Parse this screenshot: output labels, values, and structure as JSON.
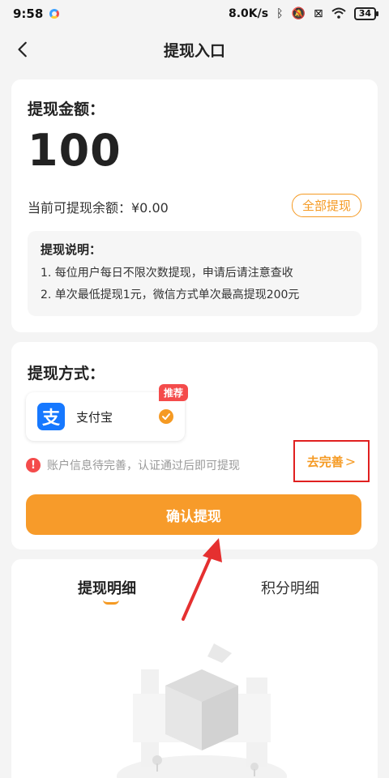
{
  "status": {
    "time": "9:58",
    "speed": "8.0K/s",
    "battery": "34"
  },
  "nav": {
    "title": "提现入口"
  },
  "amount": {
    "label": "提现金额：",
    "value": "100",
    "balance_text": "当前可提现余额：¥0.00",
    "withdraw_all": "全部提现"
  },
  "notes": {
    "title": "提现说明：",
    "lines": [
      "1. 每位用户每日不限次数提现，申请后请注意查收",
      "2. 单次最低提现1元，微信方式单次最高提现200元"
    ]
  },
  "method": {
    "label": "提现方式：",
    "option_name": "支付宝",
    "recommend_badge": "推荐",
    "logo_char": "支",
    "warning": "账户信息待完善，认证通过后即可提现",
    "complete_link": "去完善",
    "confirm_button": "确认提现"
  },
  "tabs": [
    "提现明细",
    "积分明细"
  ],
  "colors": {
    "accent": "#f79b2a",
    "alipay": "#1678ff",
    "badge": "#f44b4b"
  }
}
